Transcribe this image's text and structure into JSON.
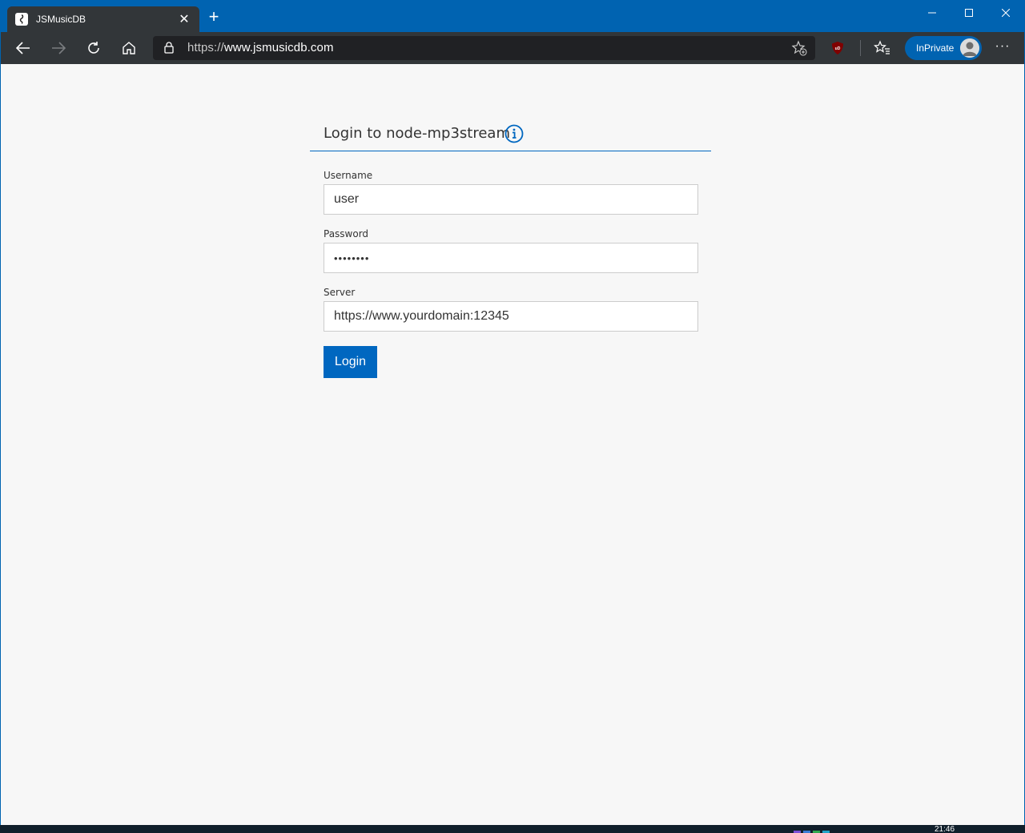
{
  "browser": {
    "tab": {
      "title": "JSMusicDB",
      "close_glyph": "✕"
    },
    "new_tab_glyph": "+",
    "window_controls": {
      "minimize": "─",
      "maximize": "☐",
      "close": "✕"
    },
    "address": {
      "scheme": "https://",
      "host": "www.jsmusicdb.com"
    },
    "inprivate_label": "InPrivate",
    "more_glyph": "···",
    "accent_color": "#0063b1"
  },
  "login": {
    "title": "Login to node-mp3stream",
    "fields": {
      "username": {
        "label": "Username",
        "value": "user"
      },
      "password": {
        "label": "Password",
        "value": "••••••••"
      },
      "server": {
        "label": "Server",
        "value": "https://www.yourdomain:12345"
      }
    },
    "submit_label": "Login",
    "accent_color": "#0067c0"
  },
  "taskbar": {
    "clock": "21:46"
  }
}
